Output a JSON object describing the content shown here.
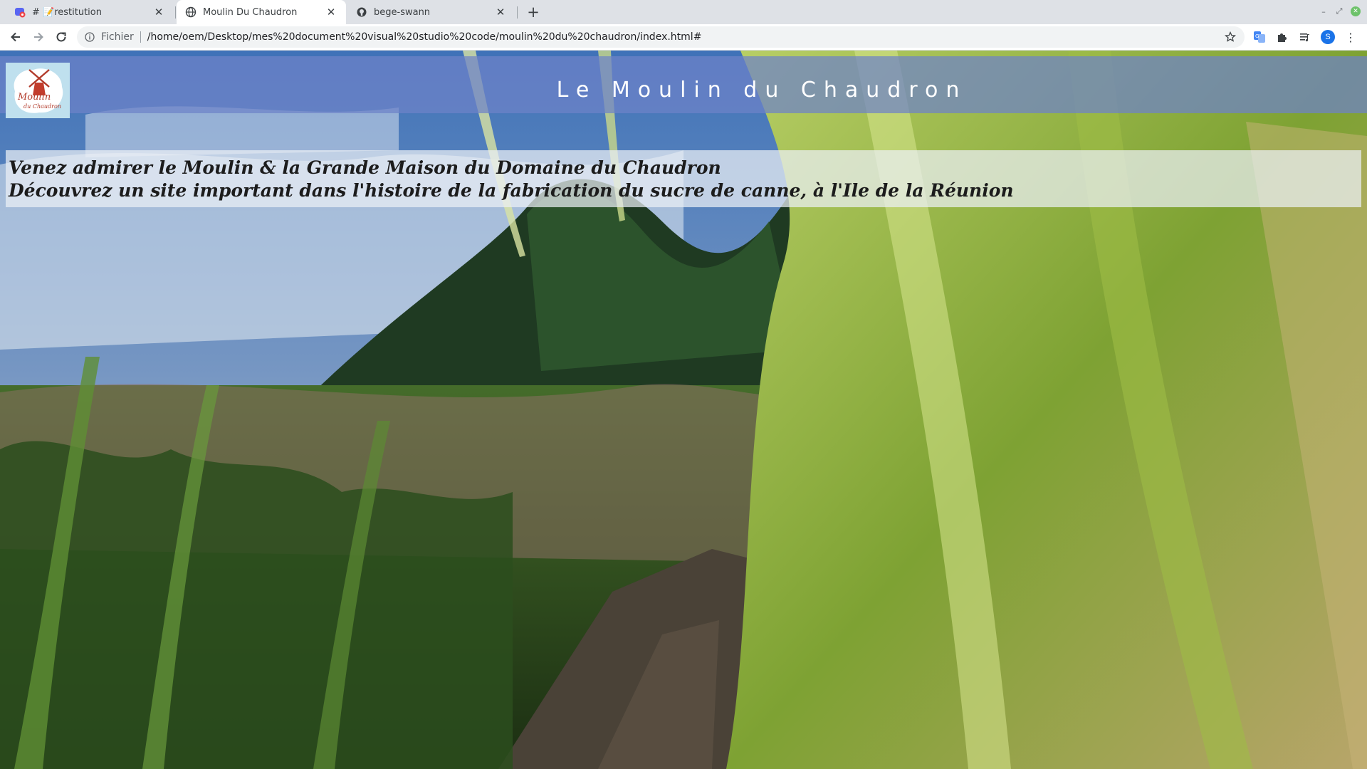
{
  "browser": {
    "tabs": [
      {
        "title": "# 📝restitution",
        "active": false,
        "favicon": "discord-favicon-icon"
      },
      {
        "title": "Moulin Du Chaudron",
        "active": true,
        "favicon": "globe-icon"
      },
      {
        "title": "bege-swann",
        "active": false,
        "favicon": "github-icon"
      }
    ],
    "omnibox": {
      "scheme_label": "Fichier",
      "url": "/home/oem/Desktop/mes%20document%20visual%20studio%20code/moulin%20du%20chaudron/index.html#"
    },
    "avatar_letter": "S"
  },
  "page": {
    "logo": {
      "text_line1": "Moulin",
      "text_line2": "du Chaudron"
    },
    "title": "Le Moulin du Chaudron",
    "banner": {
      "line1": "Venez admirer le Moulin & la Grande Maison du Domaine du Chaudron",
      "line2": "Découvrez un site important dans l'histoire de la fabrication du sucre de canne, à l'Ile de la Réunion"
    }
  },
  "colors": {
    "header_overlay": "#6e82c8",
    "banner_overlay": "#ebf0f5",
    "sky": "#5b86c2",
    "cane_green": "#4f8a2a"
  }
}
